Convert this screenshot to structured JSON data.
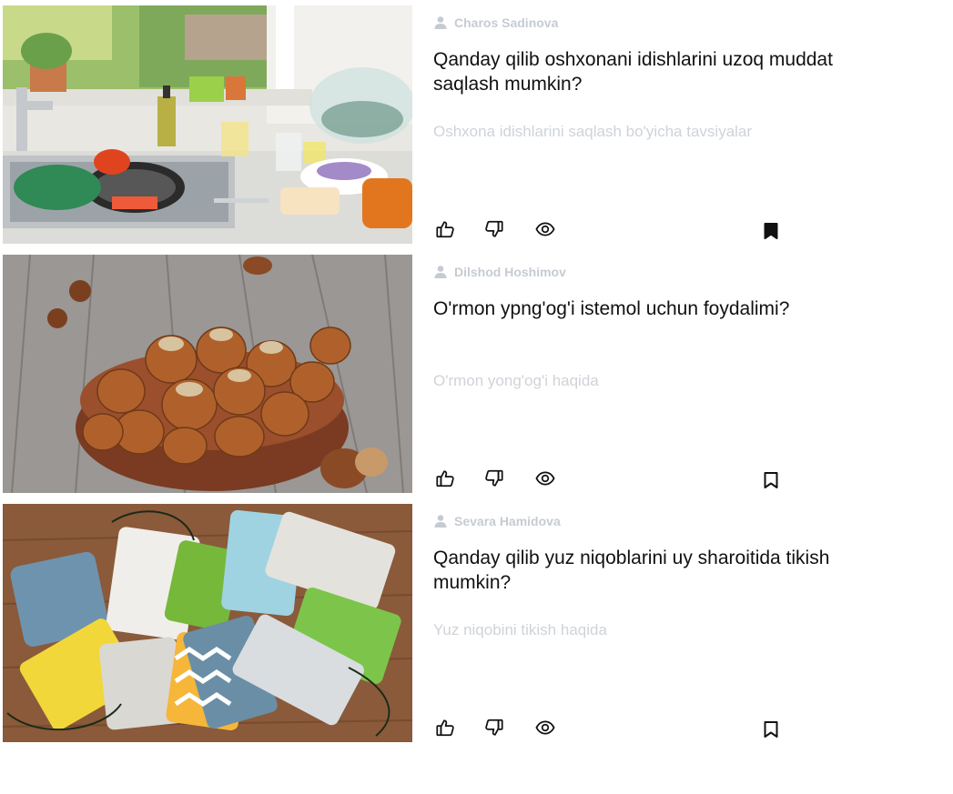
{
  "posts": [
    {
      "author": "Charos Sadinova",
      "title": "Qanday qilib oshxonani idishlarini uzoq muddat saqlash mumkin?",
      "subtitle": "Oshxona idishlarini saqlash bo'yicha tavsiyalar",
      "image": "kitchen-sink-dishes-photo",
      "bookmarked": true
    },
    {
      "author": "Dilshod Hoshimov",
      "title": "O'rmon ypng'og'i istemol uchun foydalimi?",
      "subtitle": "O'rmon yong'og'i haqida",
      "image": "hazelnuts-bowl-photo",
      "bookmarked": false
    },
    {
      "author": "Sevara Hamidova",
      "title": "Qanday qilib yuz niqoblarini uy sharoitida tikish mumkin?",
      "subtitle": "Yuz niqobini tikish haqida",
      "image": "fabric-face-masks-photo",
      "bookmarked": false
    }
  ],
  "icons": {
    "author": "user-icon",
    "like": "thumbs-up-icon",
    "dislike": "thumbs-down-icon",
    "views": "eye-icon",
    "bookmark": "bookmark-icon"
  },
  "colors": {
    "author_text": "#c6cbd3",
    "title_text": "#111111",
    "subtitle_text": "#cfd3d8",
    "icon": "#111111"
  }
}
